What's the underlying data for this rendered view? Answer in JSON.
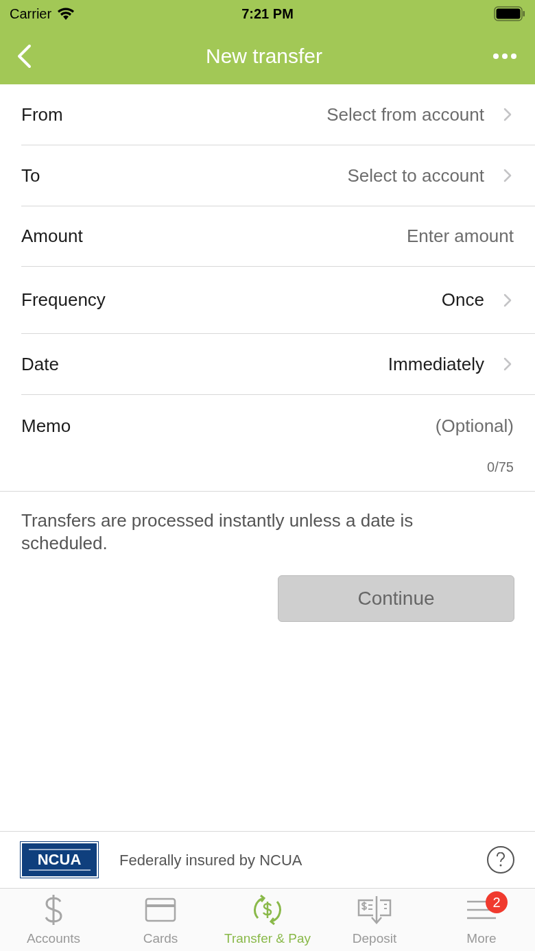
{
  "status_bar": {
    "carrier": "Carrier",
    "time": "7:21 PM"
  },
  "nav": {
    "title": "New transfer"
  },
  "fields": [
    {
      "kind": "select",
      "label": "From",
      "placeholder": "Select from account"
    },
    {
      "kind": "select",
      "label": "To",
      "placeholder": "Select to account"
    },
    {
      "kind": "input",
      "label": "Amount",
      "placeholder": "Enter amount"
    },
    {
      "kind": "select",
      "label": "Frequency",
      "value": "Once"
    },
    {
      "kind": "select",
      "label": "Date",
      "value": "Immediately"
    },
    {
      "kind": "memo",
      "label": "Memo",
      "placeholder": "(Optional)",
      "counter": "0/75"
    }
  ],
  "note": "Transfers are processed instantly unless a date is scheduled.",
  "continue_button": {
    "label": "Continue",
    "disabled": true
  },
  "footer": {
    "logo": "NCUA",
    "text": "Federally insured by NCUA"
  },
  "tabs": [
    {
      "kind": "dollar",
      "label": "Accounts",
      "selected": false
    },
    {
      "kind": "card",
      "label": "Cards",
      "selected": false
    },
    {
      "kind": "transfer",
      "label": "Transfer & Pay",
      "selected": true
    },
    {
      "kind": "deposit",
      "label": "Deposit",
      "selected": false
    },
    {
      "kind": "more",
      "label": "More",
      "selected": false,
      "badge": "2"
    }
  ]
}
